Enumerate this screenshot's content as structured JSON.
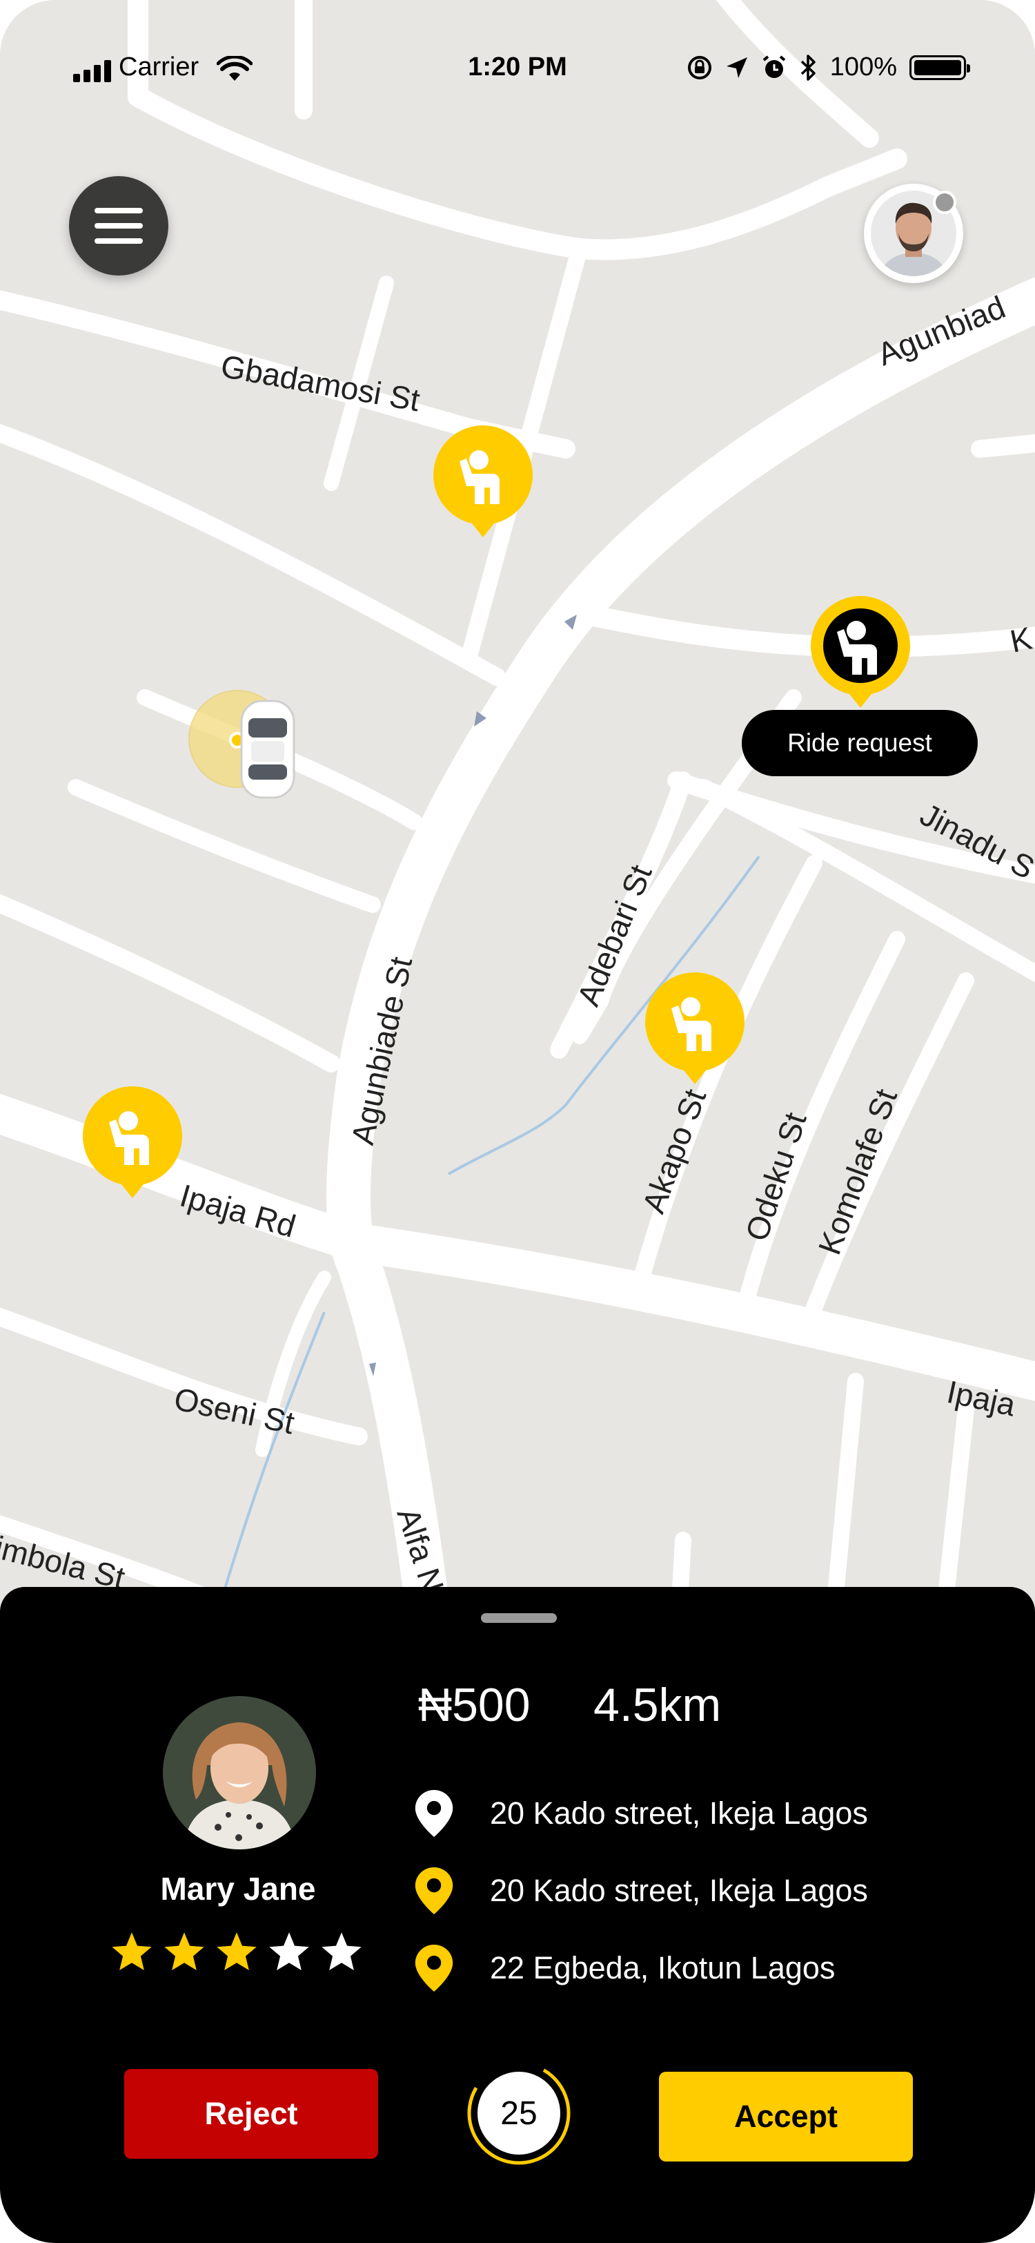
{
  "status_bar": {
    "carrier": "Carrier",
    "time": "1:20 PM",
    "battery": "100%"
  },
  "map": {
    "streets": [
      "Agunbiad",
      "Gbadamosi St",
      "Agunbiade St",
      "Adebari St",
      "Jinadu S",
      "Akapo St",
      "Odeku St",
      "Komolafe St",
      "Ipaja Rd",
      "Ipaja",
      "Oseni St",
      "Alfa N",
      "imbola St",
      "K"
    ],
    "tooltip": "Ride request",
    "colors": {
      "background": "#e8e6e3",
      "road": "#ffffff",
      "pin": "#ffcc00",
      "pin_active": "#000000"
    }
  },
  "rider": {
    "name": "Mary Jane",
    "rating": 3,
    "max_rating": 5,
    "price": "₦500",
    "distance": "4.5km"
  },
  "addresses": [
    {
      "icon": "pin-white-icon",
      "text": "20 Kado street, Ikeja Lagos"
    },
    {
      "icon": "pin-yellow-icon",
      "text": "20 Kado street, Ikeja Lagos"
    },
    {
      "icon": "pin-yellow-icon",
      "text": "22 Egbeda, Ikotun Lagos"
    }
  ],
  "actions": {
    "reject": "Reject",
    "accept": "Accept",
    "countdown": "25"
  },
  "colors": {
    "accent": "#ffcc00",
    "reject": "#c40202",
    "sheet": "#000000"
  }
}
